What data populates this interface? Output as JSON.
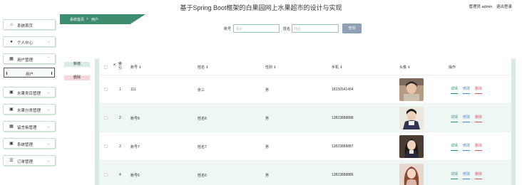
{
  "header": {
    "title": "基于Spring Boot框架的白果园网上水果超市的设计与实现",
    "admin_label": "管理员 admin",
    "logout_label": "退出登录"
  },
  "breadcrumb": {
    "home": "系统首页",
    "separator": ">",
    "current": "用户"
  },
  "sidebar": {
    "items": [
      {
        "label": "系统首页",
        "icon": "home-icon"
      },
      {
        "label": "个人中心",
        "icon": "user-icon"
      },
      {
        "label": "用户管理",
        "icon": "grid-icon"
      },
      {
        "label": "水果类目管理",
        "icon": "briefcase-icon"
      },
      {
        "label": "水果分类管理",
        "icon": "briefcase-icon"
      },
      {
        "label": "留言板管理",
        "icon": "grid-icon"
      },
      {
        "label": "系统管理",
        "icon": "briefcase-icon"
      },
      {
        "label": "订单管理",
        "icon": "list-icon"
      }
    ],
    "sub_item": "用户"
  },
  "search": {
    "account_label": "账号",
    "account_placeholder": "账号",
    "name_label": "姓名",
    "name_placeholder": "姓名",
    "button": "查询"
  },
  "actions": {
    "add": "新增",
    "delete": "删除"
  },
  "table": {
    "headers": {
      "index": "索引",
      "account": "账号",
      "name": "姓名",
      "gender": "性别",
      "phone": "手机",
      "avatar": "头像",
      "ops": "操作"
    },
    "rows": [
      {
        "index": "1",
        "account": "111",
        "name": "张三",
        "gender": "男",
        "phone": "18156541454"
      },
      {
        "index": "2",
        "account": "账号8",
        "name": "姓名8",
        "gender": "男",
        "phone": "13823888888"
      },
      {
        "index": "3",
        "account": "账号7",
        "name": "姓名7",
        "gender": "男",
        "phone": "13823888887"
      },
      {
        "index": "4",
        "account": "账号6",
        "name": "姓名6",
        "gender": "男",
        "phone": "13823888886"
      }
    ],
    "op_labels": {
      "detail": "详情",
      "edit": "修改",
      "delete": "删除"
    }
  },
  "colors": {
    "accent": "#3c8a6f",
    "add_button_bg": "#d8ebe4",
    "delete_button_bg": "#f6d6d9",
    "search_button": "#8fa0b5"
  }
}
